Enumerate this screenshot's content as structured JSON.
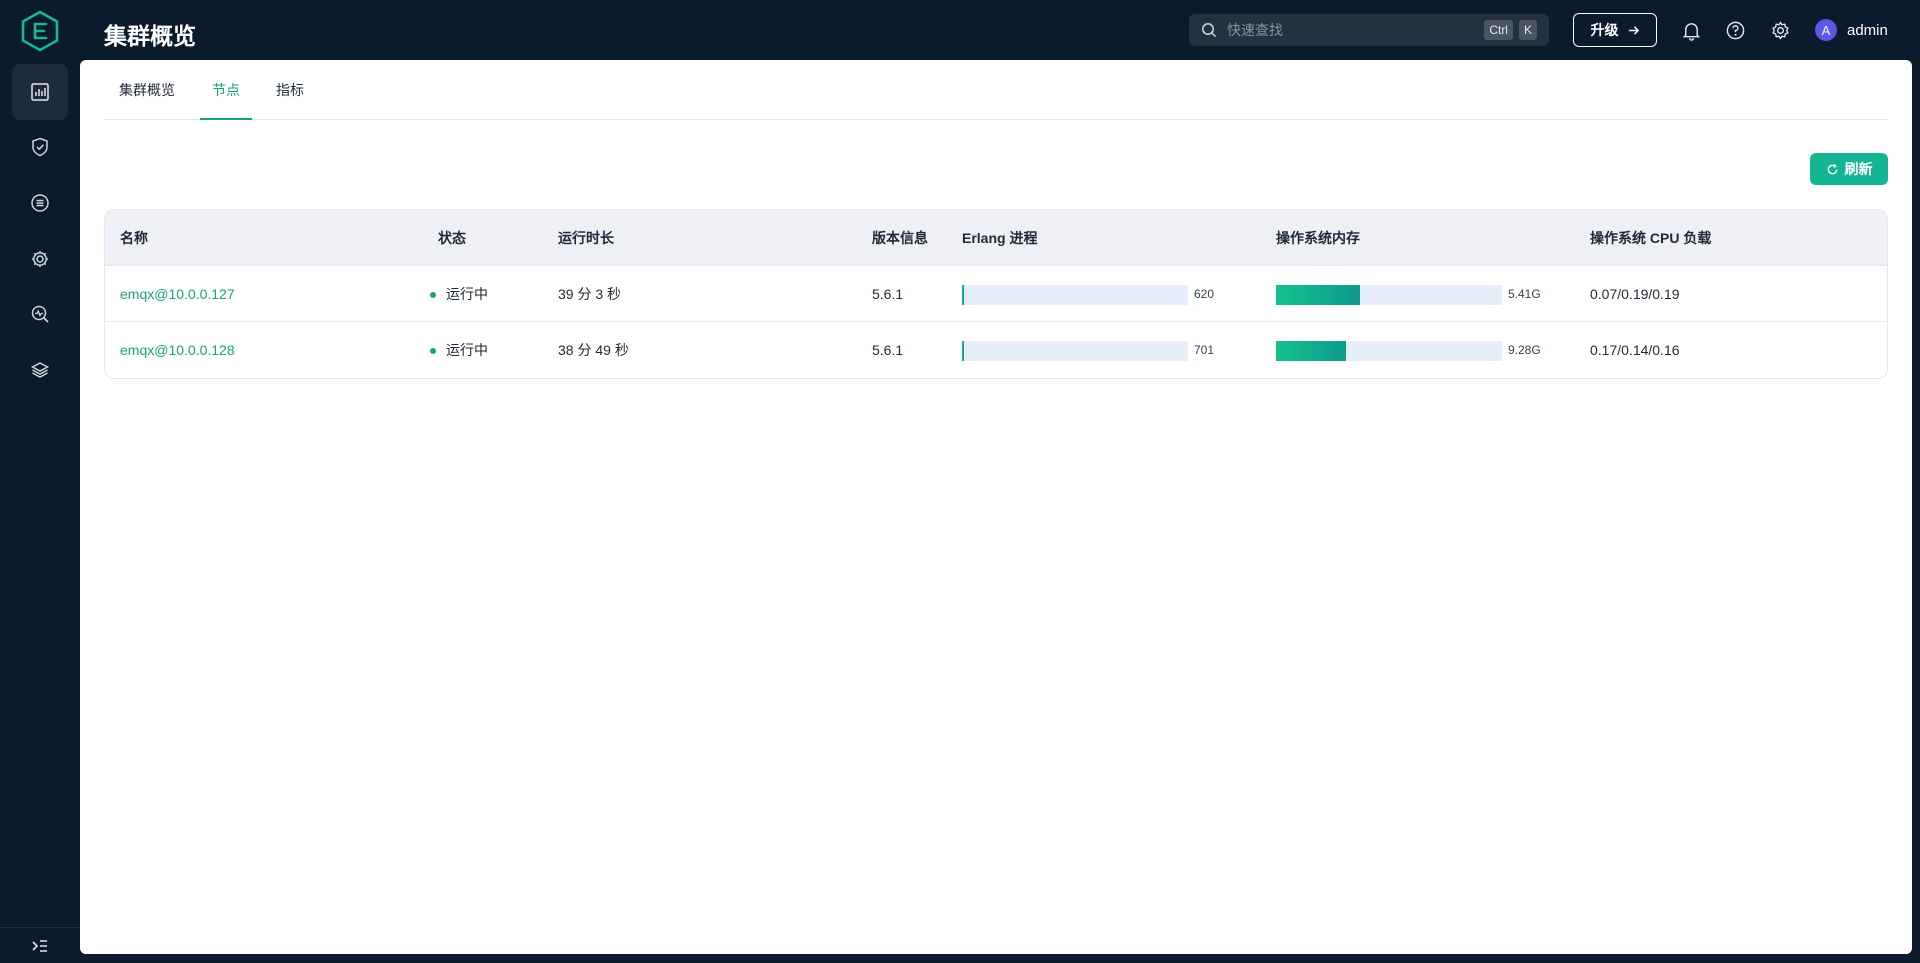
{
  "header": {
    "title": "集群概览",
    "search_placeholder": "快速查找",
    "shortcut_keys": [
      "Ctrl",
      "K"
    ],
    "upgrade_label": "升级",
    "username": "admin",
    "avatar_letter": "A"
  },
  "sidebar": {
    "items": [
      {
        "icon": "dashboard-icon",
        "active": true
      },
      {
        "icon": "shield-check-icon",
        "active": false
      },
      {
        "icon": "integration-icon",
        "active": false
      },
      {
        "icon": "management-gear-icon",
        "active": false
      },
      {
        "icon": "diagnose-icon",
        "active": false
      },
      {
        "icon": "layers-icon",
        "active": false
      }
    ],
    "collapse_icon": "collapse-menu-icon"
  },
  "tabs": [
    {
      "label": "集群概览",
      "active": false
    },
    {
      "label": "节点",
      "active": true
    },
    {
      "label": "指标",
      "active": false
    }
  ],
  "toolbar": {
    "refresh_label": "刷新"
  },
  "table": {
    "columns": [
      "名称",
      "状态",
      "运行时长",
      "版本信息",
      "Erlang 进程",
      "操作系统内存",
      "操作系统 CPU 负载"
    ],
    "rows": [
      {
        "name": "emqx@10.0.0.127",
        "status": "运行中",
        "uptime": "39 分 3 秒",
        "version": "5.6.1",
        "erlang_processes": "620",
        "erlang_fraction": 0.002,
        "memory": "5.41G",
        "memory_fraction": 0.37,
        "cpu_load": "0.07/0.19/0.19"
      },
      {
        "name": "emqx@10.0.0.128",
        "status": "运行中",
        "uptime": "38 分 49 秒",
        "version": "5.6.1",
        "erlang_processes": "701",
        "erlang_fraction": 0.002,
        "memory": "9.28G",
        "memory_fraction": 0.31,
        "cpu_load": "0.17/0.14/0.16"
      }
    ]
  },
  "colors": {
    "brand": "#14a37f",
    "sidebar_bg": "#0b1b2b",
    "header_th_bg": "#eef0f6",
    "bar_track": "#e6eefa"
  }
}
